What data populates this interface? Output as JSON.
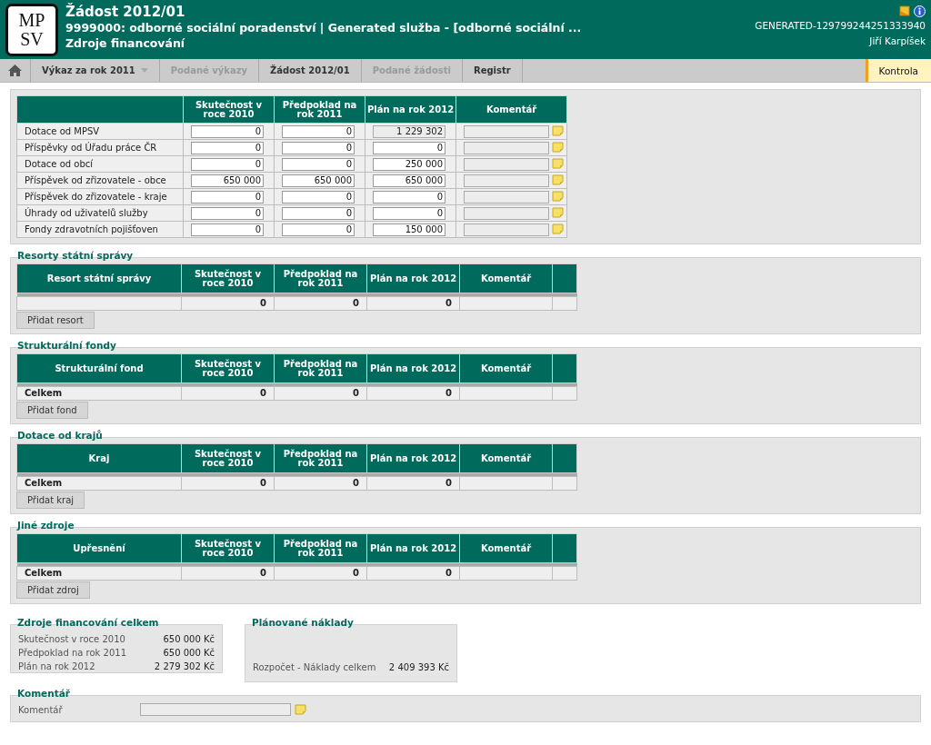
{
  "header": {
    "logo": [
      "MP",
      "SV"
    ],
    "title": "Žádost 2012/01",
    "subtitle": "9999000: odborné sociální poradenství | Generated služba - [odborné sociální ...",
    "page": "Zdroje financování",
    "code": "GENERATED-129799244251333940",
    "user": "Jiří Karpíšek"
  },
  "nav": [
    {
      "label": "Výkaz za rok 2011",
      "disabled": false,
      "dropdown": true
    },
    {
      "label": "Podané výkazy",
      "disabled": true,
      "dropdown": false
    },
    {
      "label": "Žádost 2012/01",
      "disabled": false,
      "dropdown": false
    },
    {
      "label": "Podané žádosti",
      "disabled": true,
      "dropdown": false
    },
    {
      "label": "Registr",
      "disabled": false,
      "dropdown": false
    }
  ],
  "nav_action": "Kontrola",
  "main_table": {
    "columns": [
      "Skutečnost v roce 2010",
      "Předpoklad na rok 2011",
      "Plán na rok 2012",
      "Komentář"
    ],
    "rows": [
      {
        "label": "Dotace od MPSV",
        "values": [
          {
            "value": "0",
            "disabled": false
          },
          {
            "value": "0",
            "disabled": false
          },
          {
            "value": "1 229 302",
            "disabled": true
          }
        ],
        "comment_disabled": true
      },
      {
        "label": "Příspěvky od Úřadu práce ČR",
        "values": [
          {
            "value": "0",
            "disabled": false
          },
          {
            "value": "0",
            "disabled": false
          },
          {
            "value": "0",
            "disabled": false
          }
        ],
        "comment_disabled": true
      },
      {
        "label": "Dotace od obcí",
        "values": [
          {
            "value": "0",
            "disabled": false
          },
          {
            "value": "0",
            "disabled": false
          },
          {
            "value": "250 000",
            "disabled": false
          }
        ],
        "comment_disabled": true
      },
      {
        "label": "Příspěvek od zřizovatele - obce",
        "values": [
          {
            "value": "650 000",
            "disabled": false
          },
          {
            "value": "650 000",
            "disabled": false
          },
          {
            "value": "650 000",
            "disabled": false
          }
        ],
        "comment_disabled": true
      },
      {
        "label": "Příspěvek do zřizovatele - kraje",
        "values": [
          {
            "value": "0",
            "disabled": false
          },
          {
            "value": "0",
            "disabled": false
          },
          {
            "value": "0",
            "disabled": false
          }
        ],
        "comment_disabled": true
      },
      {
        "label": "Úhrady od uživatelů služby",
        "values": [
          {
            "value": "0",
            "disabled": false
          },
          {
            "value": "0",
            "disabled": false
          },
          {
            "value": "0",
            "disabled": false
          }
        ],
        "comment_disabled": true
      },
      {
        "label": "Fondy zdravotních pojišťoven",
        "values": [
          {
            "value": "0",
            "disabled": false
          },
          {
            "value": "0",
            "disabled": false
          },
          {
            "value": "150 000",
            "disabled": false
          }
        ],
        "comment_disabled": true
      }
    ]
  },
  "sections": [
    {
      "title": "Resorty státní správy",
      "columns": [
        "Resort státní správy",
        "Skutečnost v roce 2010",
        "Předpoklad na rok 2011",
        "Plán na rok 2012",
        "Komentář"
      ],
      "row": {
        "values": [
          "0",
          "0",
          "0"
        ]
      },
      "button": "Přidat resort"
    },
    {
      "title": "Strukturální fondy",
      "columns": [
        "Strukturální fond",
        "Skutečnost v roce 2010",
        "Předpoklad na rok 2011",
        "Plán na rok 2012",
        "Komentář"
      ],
      "row": {
        "label": "Celkem",
        "values": [
          "0",
          "0",
          "0"
        ]
      },
      "button": "Přidat fond"
    },
    {
      "title": "Dotace od krajů",
      "columns": [
        "Kraj",
        "Skutečnost v roce 2010",
        "Předpoklad na rok 2011",
        "Plán na rok 2012",
        "Komentář"
      ],
      "row": {
        "label": "Celkem",
        "values": [
          "0",
          "0",
          "0"
        ]
      },
      "button": "Přidat kraj"
    },
    {
      "title": "Jiné zdroje",
      "columns": [
        "Upřesnění",
        "Skutečnost v roce 2010",
        "Předpoklad na rok 2011",
        "Plán na rok 2012",
        "Komentář"
      ],
      "row": {
        "label": "Celkem",
        "values": [
          "0",
          "0",
          "0"
        ]
      },
      "button": "Přidat zdroj"
    }
  ],
  "totals": {
    "title": "Zdroje financování celkem",
    "rows": [
      {
        "label": "Skutečnost v roce 2010",
        "value": "650 000 Kč"
      },
      {
        "label": "Předpoklad na rok 2011",
        "value": "650 000 Kč"
      },
      {
        "label": "Plán na rok 2012",
        "value": "2 279 302 Kč"
      }
    ]
  },
  "costs": {
    "title": "Plánované náklady",
    "rows": [
      {
        "label": "Rozpočet - Náklady celkem",
        "value": "2 409 393 Kč"
      }
    ]
  },
  "comment": {
    "title": "Komentář",
    "label": "Komentář"
  }
}
